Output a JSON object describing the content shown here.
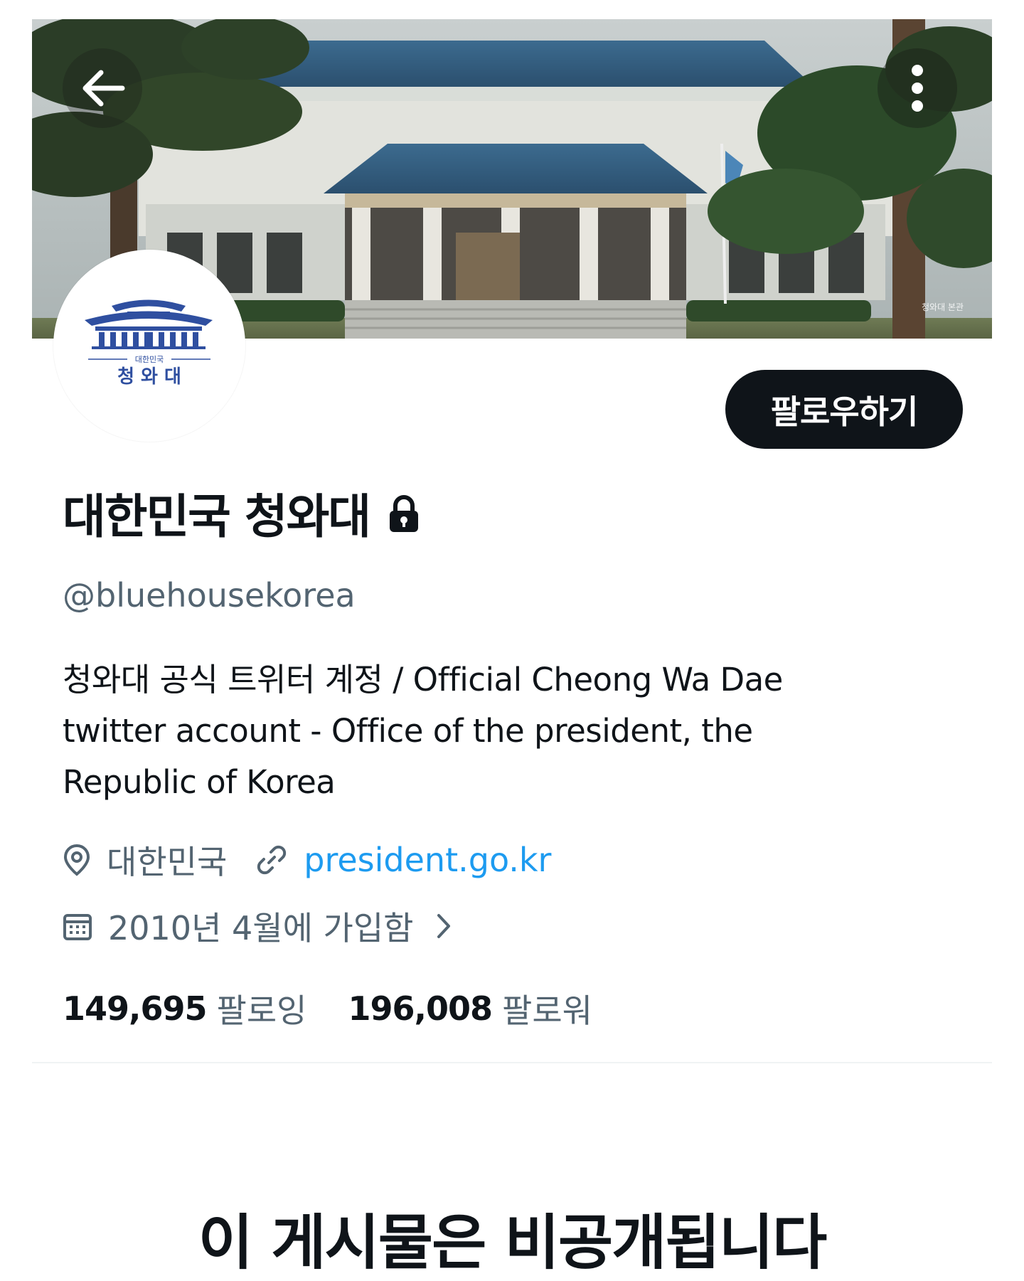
{
  "banner": {
    "watermark": "청와대 본관",
    "back_icon": "arrow-left-icon",
    "more_icon": "more-vertical-icon"
  },
  "avatar": {
    "logo_small_text": "대한민국",
    "logo_text": "청 와 대",
    "brand_color": "#2f4fa0"
  },
  "follow_button": {
    "label": "팔로우하기"
  },
  "profile": {
    "display_name": "대한민국 청와대",
    "protected_icon": "lock-icon",
    "handle": "@bluehousekorea",
    "bio_lines": [
      "청와대 공식 트위터 계정 / Official Cheong Wa Dae",
      "twitter account - Office of the president, the",
      "Republic of Korea"
    ],
    "location_icon": "location-pin-icon",
    "location": "대한민국",
    "link_icon": "link-icon",
    "website": "president.go.kr",
    "calendar_icon": "calendar-icon",
    "joined": "2010년 4월에 가입함",
    "joined_chevron_icon": "chevron-right-icon"
  },
  "stats": {
    "following_count": "149,695",
    "following_label": "팔로잉",
    "followers_count": "196,008",
    "followers_label": "팔로워"
  },
  "protected_notice": {
    "title": "이 게시물은 비공개됩니다"
  },
  "colors": {
    "primary_text": "#0f1419",
    "secondary_text": "#536471",
    "link": "#1d9bf0",
    "button_bg": "#0f1419"
  }
}
